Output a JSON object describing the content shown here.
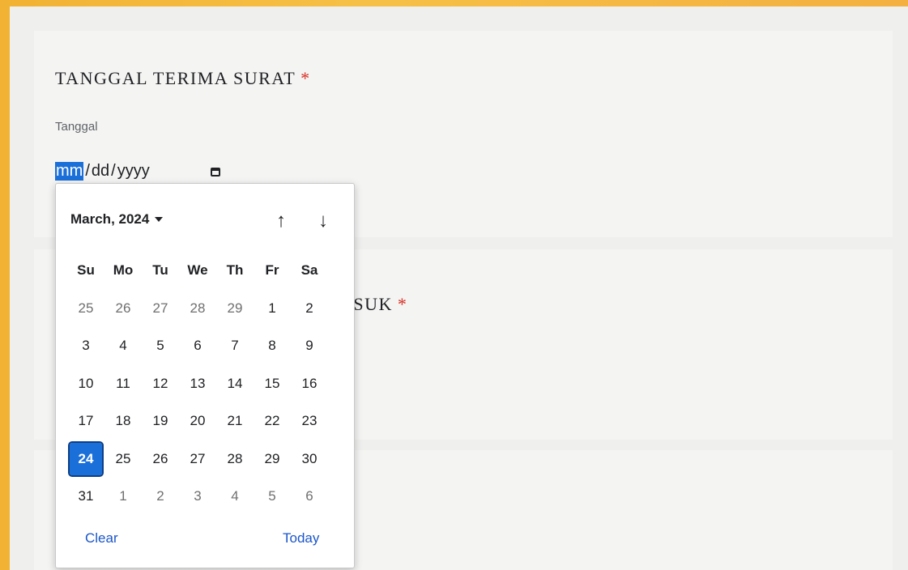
{
  "question1": {
    "title": "TANGGAL TERIMA SURAT",
    "required_mark": "*",
    "sublabel": "Tanggal"
  },
  "date_input": {
    "mm": "mm",
    "sep1": "/",
    "dd": "dd",
    "sep2": "/",
    "yyyy": "yyyy"
  },
  "question2": {
    "title_visible": "ASUK",
    "required_mark": "*"
  },
  "picker": {
    "month_label": "March, 2024",
    "weekdays": [
      "Su",
      "Mo",
      "Tu",
      "We",
      "Th",
      "Fr",
      "Sa"
    ],
    "days": [
      [
        "25",
        "26",
        "27",
        "28",
        "29",
        "1",
        "2"
      ],
      [
        "3",
        "4",
        "5",
        "6",
        "7",
        "8",
        "9"
      ],
      [
        "10",
        "11",
        "12",
        "13",
        "14",
        "15",
        "16"
      ],
      [
        "17",
        "18",
        "19",
        "20",
        "21",
        "22",
        "23"
      ],
      [
        "24",
        "25",
        "26",
        "27",
        "28",
        "29",
        "30"
      ],
      [
        "31",
        "1",
        "2",
        "3",
        "4",
        "5",
        "6"
      ]
    ],
    "dim_cells": [
      [
        0,
        0
      ],
      [
        0,
        1
      ],
      [
        0,
        2
      ],
      [
        0,
        3
      ],
      [
        0,
        4
      ],
      [
        5,
        1
      ],
      [
        5,
        2
      ],
      [
        5,
        3
      ],
      [
        5,
        4
      ],
      [
        5,
        5
      ],
      [
        5,
        6
      ]
    ],
    "selected_cell": [
      4,
      0
    ],
    "clear_label": "Clear",
    "today_label": "Today"
  },
  "icons": {
    "calendar": "calendar-icon",
    "prev": "arrow-up-icon",
    "next": "arrow-down-icon"
  },
  "colors": {
    "accent": "#1a6fd9",
    "required": "#d93025",
    "link": "#1a56c9"
  }
}
